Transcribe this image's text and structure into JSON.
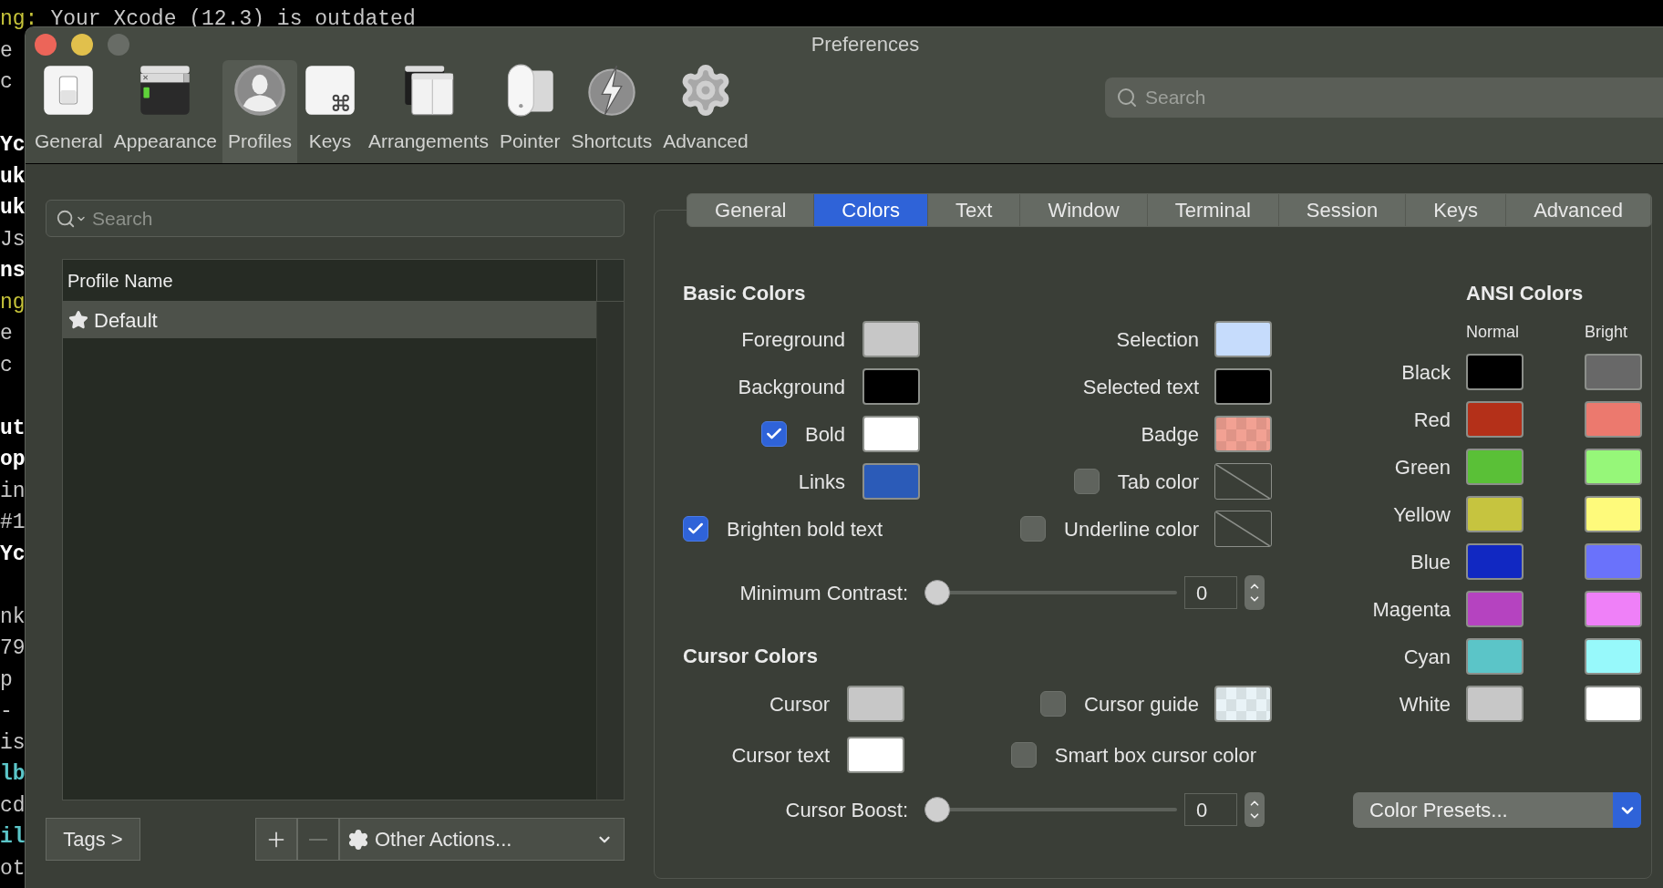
{
  "terminal": {
    "blocks": [
      [
        {
          "segments": [
            {
              "text": "ng:",
              "kind": "yellow"
            },
            {
              "text": "Your Xcode (12.3) is outdated",
              "kind": "plain"
            }
          ]
        },
        {
          "text": "e",
          "kind": "plain"
        },
        {
          "text": "c",
          "kind": "plain"
        }
      ],
      [
        {
          "text": "Yc",
          "kind": "bold"
        },
        {
          "text": "uk",
          "kind": "bold"
        },
        {
          "text": "uk",
          "kind": "bold"
        },
        {
          "text": "Js",
          "kind": "plain"
        },
        {
          "text": "ns",
          "kind": "bold"
        },
        {
          "text": "ng",
          "kind": "yellow"
        },
        {
          "text": "e",
          "kind": "plain"
        },
        {
          "text": "c",
          "kind": "plain"
        }
      ],
      [
        {
          "text": "ut",
          "kind": "bold"
        },
        {
          "text": "op",
          "kind": "bold"
        },
        {
          "text": "in",
          "kind": "plain"
        },
        {
          "text": "#1",
          "kind": "plain"
        },
        {
          "text": "Yc",
          "kind": "bold"
        }
      ],
      [
        {
          "text": "nk",
          "kind": "plain"
        },
        {
          "text": "79",
          "kind": "plain"
        },
        {
          "text": "p",
          "kind": "plain"
        },
        {
          "text": "-",
          "kind": "plain"
        },
        {
          "text": "is",
          "kind": "plain"
        },
        {
          "text": "lb",
          "kind": "cyan"
        },
        {
          "text": "cd",
          "kind": "plain"
        },
        {
          "text": "il",
          "kind": "cyan"
        },
        {
          "text": "ot",
          "kind": "plain"
        }
      ]
    ]
  },
  "window": {
    "title": "Preferences"
  },
  "toolbar": {
    "items": [
      {
        "label": "General",
        "kind": "switch",
        "selected": false
      },
      {
        "label": "Appearance",
        "kind": "window",
        "selected": false
      },
      {
        "label": "Profiles",
        "kind": "person",
        "selected": true
      },
      {
        "label": "Keys",
        "kind": "command",
        "selected": false
      },
      {
        "label": "Arrangements",
        "kind": "panes",
        "selected": false
      },
      {
        "label": "Pointer",
        "kind": "mouse",
        "selected": false
      },
      {
        "label": "Shortcuts",
        "kind": "bolt",
        "selected": false
      },
      {
        "label": "Advanced",
        "kind": "gear",
        "selected": false
      }
    ],
    "search": {
      "placeholder": "Search"
    }
  },
  "profiles": {
    "search": {
      "placeholder": "Search"
    },
    "columns": [
      "Profile Name"
    ],
    "rows": [
      {
        "name": "Default",
        "starred": true,
        "selected": true
      }
    ],
    "tags_button": "Tags >",
    "list_buttons": [
      {
        "kind": "add",
        "disabled": false
      },
      {
        "kind": "remove",
        "disabled": true
      }
    ],
    "actions_button": "Other Actions..."
  },
  "tabs": [
    {
      "label": "General",
      "selected": false
    },
    {
      "label": "Colors",
      "selected": true
    },
    {
      "label": "Text",
      "selected": false
    },
    {
      "label": "Window",
      "selected": false
    },
    {
      "label": "Terminal",
      "selected": false
    },
    {
      "label": "Session",
      "selected": false
    },
    {
      "label": "Keys",
      "selected": false
    },
    {
      "label": "Advanced",
      "selected": false
    }
  ],
  "basic_colors": {
    "title": "Basic Colors",
    "rows": [
      {
        "left": {
          "label": "Foreground",
          "swatch": {
            "kind": "solid",
            "color": "#c7c7c7"
          }
        },
        "right": {
          "label": "Selection",
          "swatch": {
            "kind": "solid",
            "color": "#c6dcfc"
          }
        }
      },
      {
        "left": {
          "label": "Background",
          "swatch": {
            "kind": "solid",
            "color": "#000000"
          }
        },
        "right": {
          "label": "Selected text",
          "swatch": {
            "kind": "solid",
            "color": "#000000"
          }
        }
      },
      {
        "left": {
          "label": "Bold",
          "checked": true,
          "swatch": {
            "kind": "solid",
            "color": "#ffffff"
          }
        },
        "right": {
          "label": "Badge",
          "swatch": {
            "kind": "checker",
            "color": "#f2a193"
          }
        }
      },
      {
        "left": {
          "label": "Links",
          "swatch": {
            "kind": "solid",
            "color": "#2b5bb8"
          }
        },
        "right": {
          "label": "Tab color",
          "checked": false,
          "swatch": {
            "kind": "none"
          }
        }
      },
      {
        "left": {
          "label": "Brighten bold text",
          "checked": true
        },
        "right": {
          "label": "Underline color",
          "checked": false,
          "swatch": {
            "kind": "none"
          }
        }
      }
    ],
    "slider": {
      "label": "Minimum Contrast:",
      "level": 0,
      "value": "0"
    }
  },
  "cursor_colors": {
    "title": "Cursor Colors",
    "rows": [
      {
        "left": {
          "label": "Cursor",
          "swatch": {
            "kind": "solid",
            "color": "#c7c7c7"
          }
        },
        "right": {
          "label": "Cursor guide",
          "checked": false,
          "swatch": {
            "kind": "checker",
            "color": "#e9f3f7"
          }
        }
      },
      {
        "left": {
          "label": "Cursor text",
          "swatch": {
            "kind": "solid",
            "color": "#ffffff"
          }
        },
        "right": {
          "label": "Smart box cursor color",
          "checked": false
        }
      }
    ],
    "slider": {
      "label": "Cursor Boost:",
      "level": 0,
      "value": "0"
    }
  },
  "ansi_colors": {
    "title": "ANSI Colors",
    "columns": [
      "Normal",
      "Bright"
    ],
    "rows": [
      {
        "label": "Black",
        "swatches": [
          {
            "color": "#000000"
          },
          {
            "color": "#686868"
          }
        ]
      },
      {
        "label": "Red",
        "swatches": [
          {
            "color": "#b43019"
          },
          {
            "color": "#ec796e"
          }
        ]
      },
      {
        "label": "Green",
        "swatches": [
          {
            "color": "#5ac037"
          },
          {
            "color": "#96f779"
          }
        ]
      },
      {
        "label": "Yellow",
        "swatches": [
          {
            "color": "#c6c43f"
          },
          {
            "color": "#fefa7b"
          }
        ]
      },
      {
        "label": "Blue",
        "swatches": [
          {
            "color": "#1128c2"
          },
          {
            "color": "#6a72fb"
          }
        ]
      },
      {
        "label": "Magenta",
        "swatches": [
          {
            "color": "#b543c0"
          },
          {
            "color": "#ef80f8"
          }
        ]
      },
      {
        "label": "Cyan",
        "swatches": [
          {
            "color": "#5bc5c8"
          },
          {
            "color": "#97f9fb"
          }
        ]
      },
      {
        "label": "White",
        "swatches": [
          {
            "color": "#c7c7c7"
          },
          {
            "color": "#ffffff"
          }
        ]
      }
    ],
    "presets_button": "Color Presets..."
  }
}
